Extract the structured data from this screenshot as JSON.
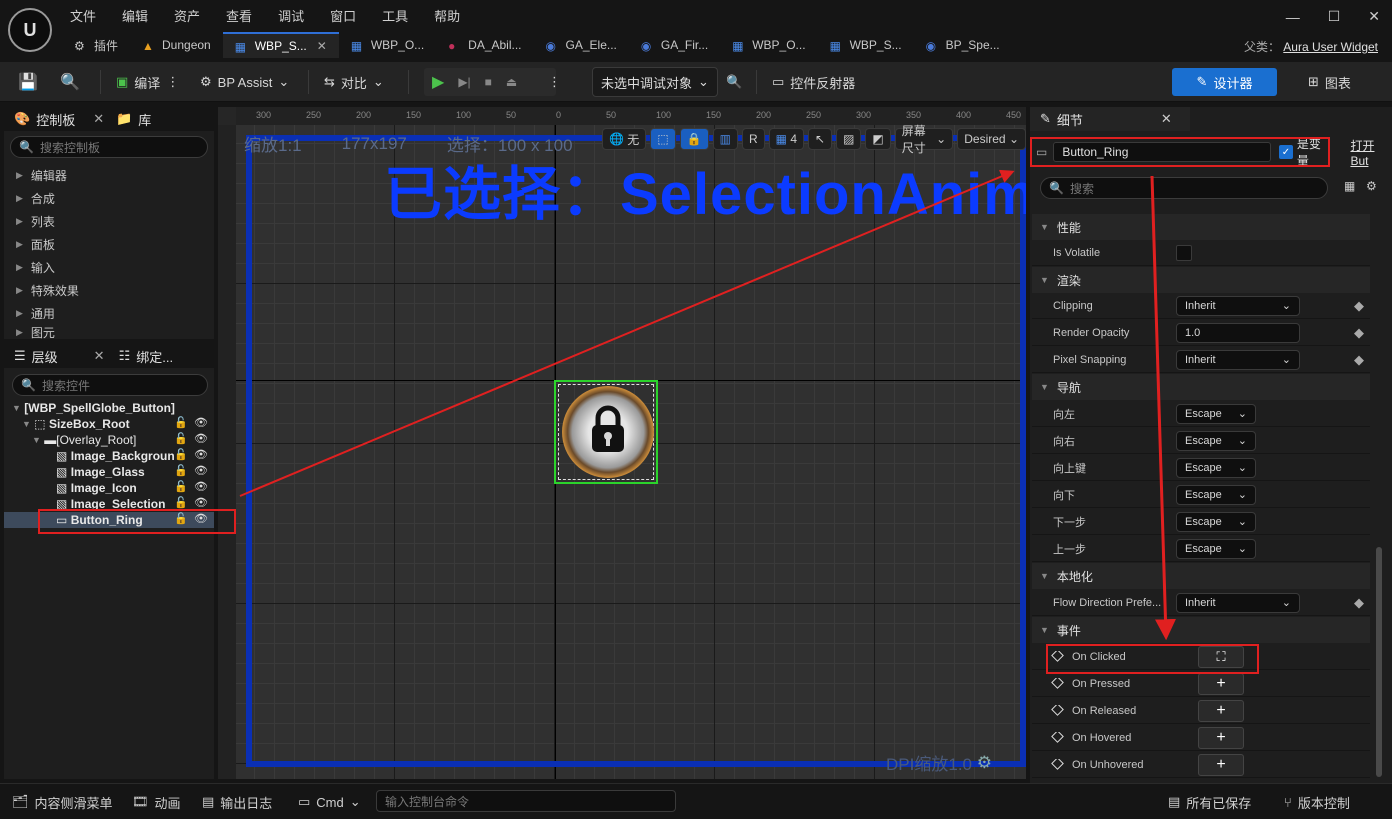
{
  "menu": [
    "文件",
    "编辑",
    "资产",
    "查看",
    "调试",
    "窗口",
    "工具",
    "帮助"
  ],
  "tabs": [
    {
      "label": "插件",
      "active": false
    },
    {
      "label": "Dungeon",
      "active": false
    },
    {
      "label": "WBP_S...",
      "active": true
    },
    {
      "label": "WBP_O...",
      "active": false
    },
    {
      "label": "DA_Abil...",
      "active": false
    },
    {
      "label": "GA_Ele...",
      "active": false
    },
    {
      "label": "GA_Fir...",
      "active": false
    },
    {
      "label": "WBP_O...",
      "active": false
    },
    {
      "label": "WBP_S...",
      "active": false
    },
    {
      "label": "BP_Spe...",
      "active": false
    }
  ],
  "parent_label": "父类：",
  "parent_value": "Aura User Widget",
  "toolbar": {
    "compile": "编译",
    "bp_assist": "BP Assist",
    "diff": "对比",
    "debug_target": "未选中调试对象",
    "widget_reflector": "控件反射器",
    "designer": "设计器",
    "graph": "图表"
  },
  "palette": {
    "title": "控制板",
    "library": "库",
    "search_placeholder": "搜索控制板",
    "items": [
      "编辑器",
      "合成",
      "列表",
      "面板",
      "输入",
      "特殊效果",
      "通用",
      "图元"
    ]
  },
  "hierarchy": {
    "title": "层级",
    "bindings": "绑定...",
    "search_placeholder": "搜索控件",
    "items": [
      {
        "label": "[WBP_SpellGlobe_Button]",
        "depth": 0
      },
      {
        "label": "SizeBox_Root",
        "depth": 1
      },
      {
        "label": "[Overlay_Root]",
        "depth": 2
      },
      {
        "label": "Image_Backgroun",
        "depth": 3
      },
      {
        "label": "Image_Glass",
        "depth": 3
      },
      {
        "label": "Image_Icon",
        "depth": 3
      },
      {
        "label": "Image_Selection",
        "depth": 3
      },
      {
        "label": "Button_Ring",
        "depth": 3,
        "selected": true
      }
    ]
  },
  "canvas": {
    "zoom": "缩放1:1",
    "size": "177x197",
    "selection": "选择：100 x 100",
    "selected_banner": "已选择：SelectionAnim",
    "screen_size": "屏幕尺寸",
    "desired": "Desired",
    "view_none": "无",
    "grid_count": "4",
    "r_label": "R",
    "dpi": "DPI缩放1.0",
    "ruler_top": [
      "300",
      "250",
      "200",
      "150",
      "100",
      "50",
      "0",
      "50",
      "100",
      "150",
      "200",
      "250",
      "300",
      "350",
      "400",
      "450"
    ]
  },
  "details": {
    "title": "细节",
    "widget_name": "Button_Ring",
    "is_variable_label": "是变量",
    "open_link": "打开But",
    "search_placeholder": "搜索",
    "categories": {
      "performance": "性能",
      "render": "渲染",
      "navigation": "导航",
      "localization": "本地化",
      "events": "事件"
    },
    "is_volatile": "Is Volatile",
    "clipping": {
      "label": "Clipping",
      "value": "Inherit"
    },
    "render_opacity": {
      "label": "Render Opacity",
      "value": "1.0"
    },
    "pixel_snapping": {
      "label": "Pixel Snapping",
      "value": "Inherit"
    },
    "nav": [
      {
        "label": "向左",
        "value": "Escape"
      },
      {
        "label": "向右",
        "value": "Escape"
      },
      {
        "label": "向上键",
        "value": "Escape"
      },
      {
        "label": "向下",
        "value": "Escape"
      },
      {
        "label": "下一步",
        "value": "Escape"
      },
      {
        "label": "上一步",
        "value": "Escape"
      }
    ],
    "flow_direction": {
      "label": "Flow Direction Prefe...",
      "value": "Inherit"
    },
    "events": [
      "On Clicked",
      "On Pressed",
      "On Released",
      "On Hovered",
      "On Unhovered"
    ]
  },
  "status": {
    "content_drawer": "内容侧滑菜单",
    "animation": "动画",
    "output_log": "输出日志",
    "cmd": "Cmd",
    "console_placeholder": "输入控制台命令",
    "all_saved": "所有已保存",
    "source_control": "版本控制"
  },
  "colors": {
    "accent": "#1a6fd0",
    "annotation": "#e02020",
    "banner": "#0b3bff",
    "selection": "#2bd42b"
  }
}
